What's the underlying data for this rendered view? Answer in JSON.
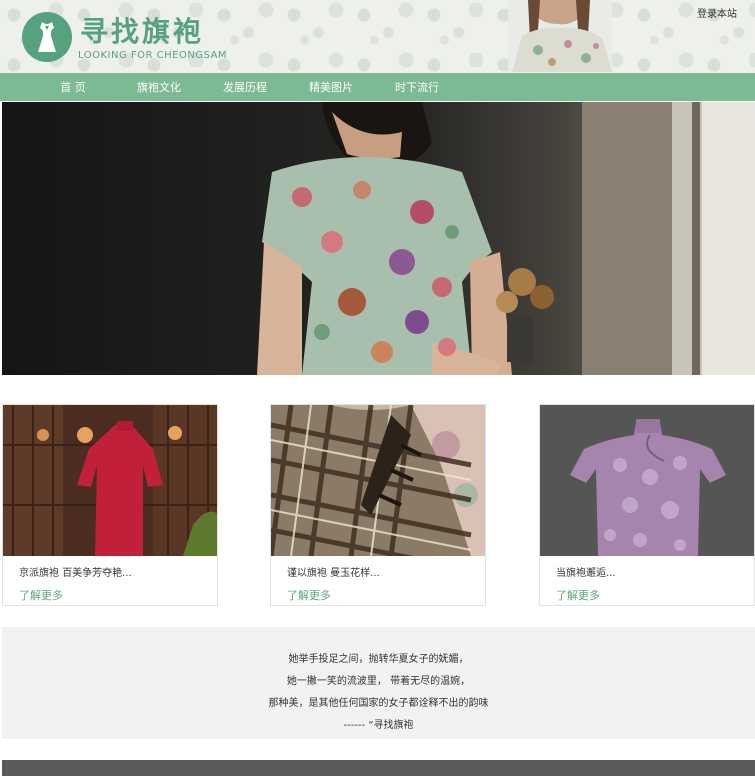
{
  "header": {
    "logo_title": "寻找旗袍",
    "logo_subtitle": "LOOKING FOR CHEONGSAM",
    "login": "登录本站"
  },
  "nav": {
    "items": [
      "首 页",
      "旗袍文化",
      "发展历程",
      "精美图片",
      "时下流行"
    ]
  },
  "cards": [
    {
      "title": "京派旗袍 百美争芳夺艳...",
      "more": "了解更多"
    },
    {
      "title": "谨以旗袍 曼玉花样...",
      "more": "了解更多"
    },
    {
      "title": "当旗袍邂逅...",
      "more": "了解更多"
    }
  ],
  "quote": {
    "lines": [
      "她举手投足之间，抛转华夏女子的妩媚，",
      "她一撇一笑的流波里， 带着无尽的温婉，",
      "那种美，是其他任何国家的女子都诠释不出的韵味",
      "------ “寻找旗袍"
    ]
  },
  "colors": {
    "brand_green": "#56a27f",
    "nav_green": "#7cba93",
    "link_green": "#5ea57c"
  }
}
